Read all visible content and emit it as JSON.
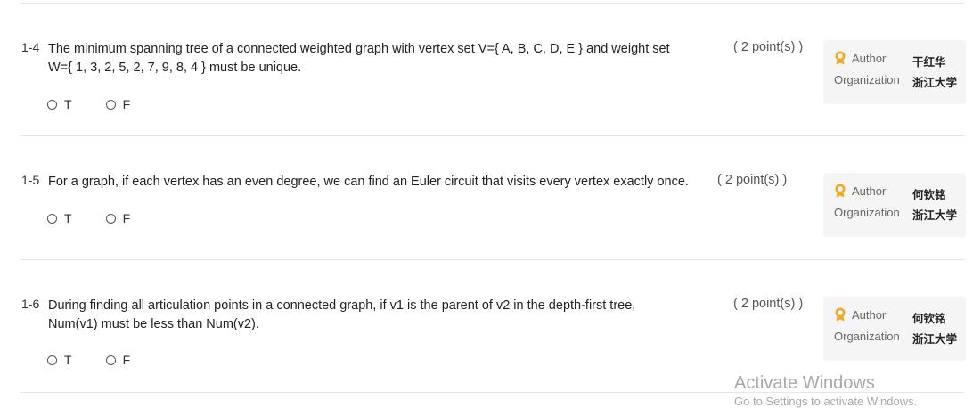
{
  "questions": [
    {
      "number": "1-4",
      "line1": "The minimum spanning tree of a connected weighted graph with vertex set V={ A, B, C, D, E } and weight set",
      "line2": "W={ 1, 3, 2, 5, 2, 7, 9, 8, 4 } must be unique.",
      "points": "( 2 point(s) )",
      "options": [
        "T",
        "F"
      ],
      "author_label": "Author",
      "author": "干红华",
      "org_label": "Organization",
      "org": "浙江大学"
    },
    {
      "number": "1-5",
      "line1": "For a graph, if each vertex has an even degree, we can find an Euler circuit that visits every vertex exactly once.",
      "line2": "",
      "points": "( 2 point(s) )",
      "options": [
        "T",
        "F"
      ],
      "author_label": "Author",
      "author": "何钦铭",
      "org_label": "Organization",
      "org": "浙江大学"
    },
    {
      "number": "1-6",
      "line1": "During finding all articulation points in a connected graph, if v1 is the parent of v2 in the depth-first tree,",
      "line2": "Num(v1) must be less than Num(v2).",
      "points": "( 2 point(s) )",
      "options": [
        "T",
        "F"
      ],
      "author_label": "Author",
      "author": "何钦铭",
      "org_label": "Organization",
      "org": "浙江大学"
    }
  ],
  "watermark": {
    "title": "Activate Windows",
    "subtitle": "Go to Settings to activate Windows."
  },
  "colors": {
    "author_icon": "#f5a623",
    "watermark": "#a8a8a8"
  }
}
